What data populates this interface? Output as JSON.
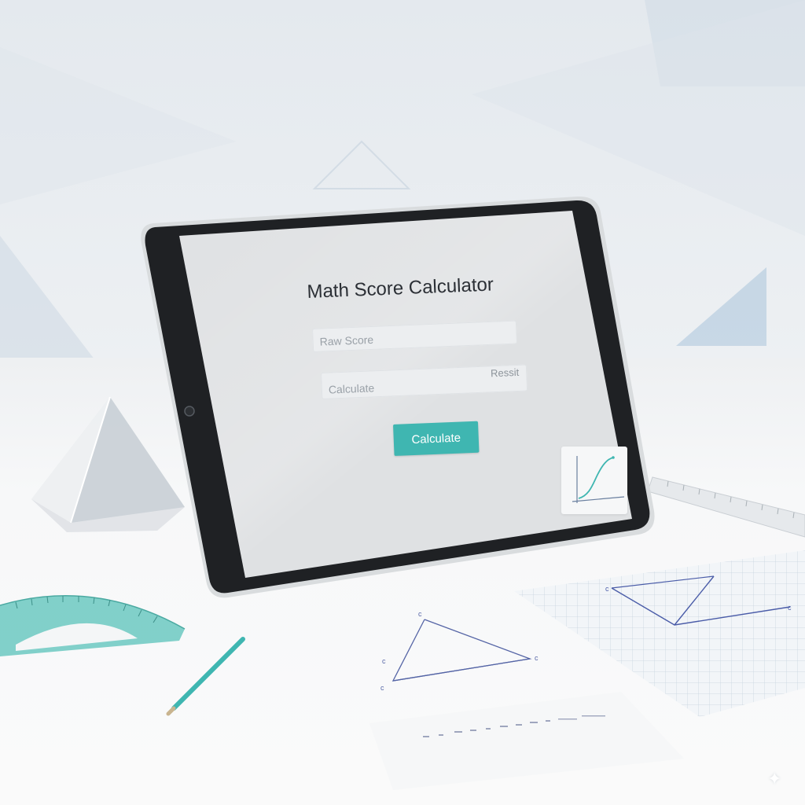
{
  "app": {
    "title": "Math Score Calculator"
  },
  "form": {
    "raw_score_placeholder": "Raw Score",
    "result_field_placeholder": "Calculate",
    "result_field_label": "Ressit",
    "calculate_button_label": "Calculate"
  },
  "worksheet": {
    "triangle_labels": [
      "c",
      "c",
      "c",
      "c"
    ],
    "grid_triangle_labels": [
      "c",
      "c"
    ]
  },
  "icons": [
    "chart-icon",
    "prism-icon",
    "protractor-icon",
    "pencil-icon",
    "ruler-icon",
    "sparkle-icon"
  ],
  "colors": {
    "accent": "#3fb6b1",
    "title_text": "#2b2f35",
    "placeholder_text": "#9aa1a8",
    "bezel": "#1f2124",
    "teal_tools": "#6cc9c1"
  }
}
